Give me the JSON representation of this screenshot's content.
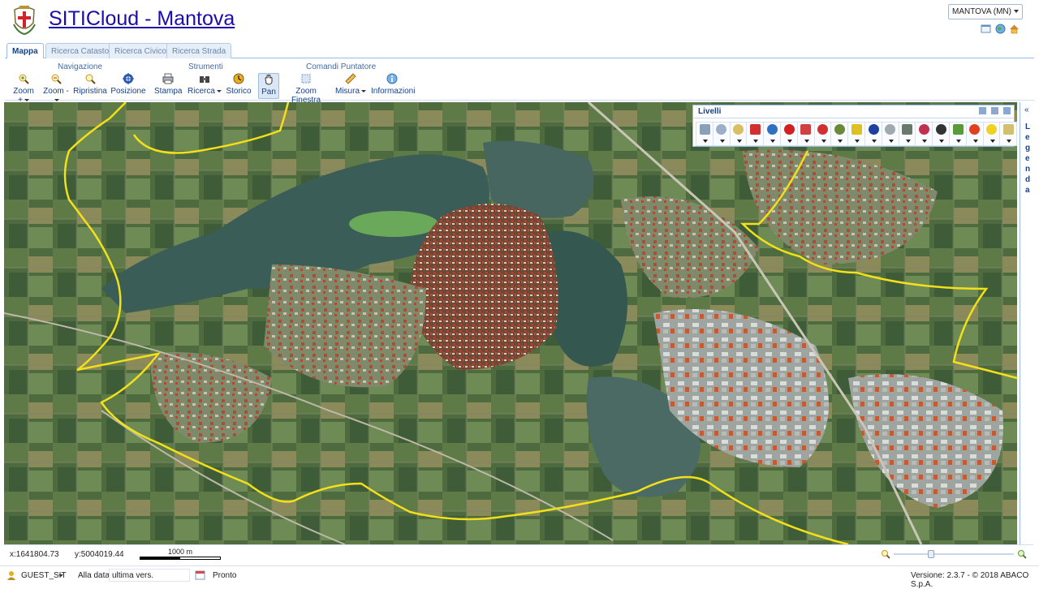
{
  "app": {
    "title": "SITICloud - Mantova"
  },
  "header": {
    "city_select": "MANTOVA (MN)",
    "icons": [
      "window-icon",
      "globe-icon",
      "home-icon"
    ]
  },
  "tabs": [
    {
      "label": "Mappa",
      "active": true
    },
    {
      "label": "Ricerca Catasto",
      "active": false
    },
    {
      "label": "Ricerca Civico",
      "active": false
    },
    {
      "label": "Ricerca Strada",
      "active": false
    }
  ],
  "toolbar": {
    "groups": {
      "navigazione": "Navigazione",
      "strumenti": "Strumenti",
      "comandi": "Comandi Puntatore"
    },
    "buttons": {
      "zoom_in": "Zoom +",
      "zoom_out": "Zoom -",
      "ripristina": "Ripristina",
      "posizione": "Posizione",
      "stampa": "Stampa",
      "ricerca": "Ricerca",
      "storico": "Storico",
      "pan": "Pan",
      "zoom_finestra": "Zoom Finestra",
      "misura": "Misura",
      "informazioni": "Informazioni"
    }
  },
  "layers": {
    "title": "Livelli",
    "icons": [
      "photo-layer-icon",
      "tree-layer-icon",
      "cadastre-layer-icon",
      "zoning-layer-icon",
      "bike-layer-icon",
      "hazard-layer-icon",
      "rail-layer-icon",
      "stop-layer-icon",
      "grid-layer-icon",
      "warning-layer-icon",
      "flame-layer-icon",
      "road-layer-icon",
      "terrain-layer-icon",
      "pipe-layer-icon",
      "accessibility-layer-icon",
      "chart-layer-icon",
      "poi-layer-icon",
      "light-layer-icon",
      "ortho-layer-icon"
    ]
  },
  "legend": {
    "label": "Legenda",
    "toggle": "«"
  },
  "coords": {
    "x": "x:1641804.73",
    "y": "y:5004019.44"
  },
  "scale": {
    "label": "1000 m"
  },
  "zoom_level": 0.3,
  "status": {
    "user": "GUEST_SIT",
    "date_label": "Alla data",
    "date_value": "ultima vers.",
    "state": "Pronto",
    "version": "Versione: 2.3.7 - © 2018 ABACO S.p.A."
  },
  "colors": {
    "accent": "#15428b",
    "boundary": "#f2e01a",
    "lake": "#3a5d57",
    "urban": "#8a3a2a"
  }
}
